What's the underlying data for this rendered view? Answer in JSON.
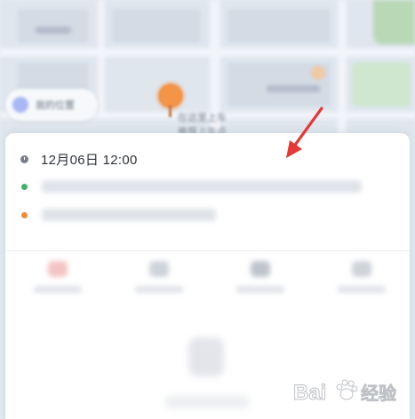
{
  "map": {
    "location_chip_label": "我的位置",
    "pickup_label_line1": "在这里上车",
    "pickup_label_line2": "推荐上车点"
  },
  "trip_sheet": {
    "time": "12月06日 12:00",
    "start_address": "",
    "end_address": "",
    "status_colors": {
      "clock": "#7b7f87",
      "start": "#3fb36a",
      "end": "#f08a3c"
    },
    "actions": [
      {
        "icon": "action-icon-1"
      },
      {
        "icon": "action-icon-2"
      },
      {
        "icon": "action-icon-3"
      },
      {
        "icon": "action-icon-4"
      }
    ]
  },
  "annotation": {
    "arrow_color": "#e53935"
  },
  "watermark": {
    "brand": "Bai",
    "brand_suffix": "经验",
    "logo_icon": "paw-icon"
  }
}
